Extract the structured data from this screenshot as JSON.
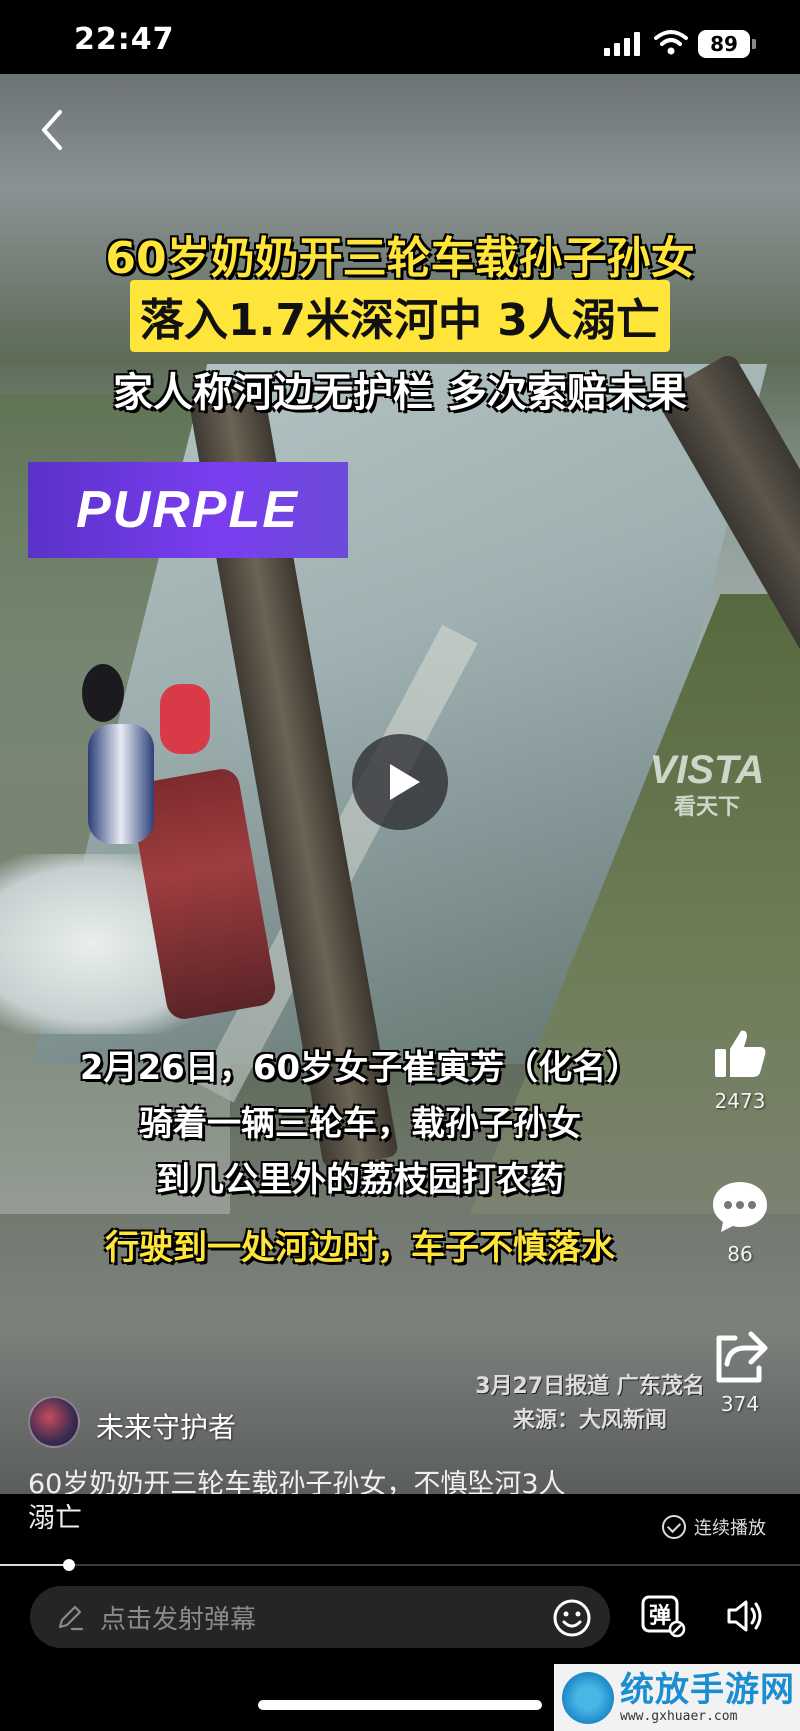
{
  "status_bar": {
    "time": "22:47",
    "battery": "89"
  },
  "video": {
    "title_lines": [
      "60岁奶奶开三轮车载孙子孙女",
      "落入1.7米深河中 3人溺亡",
      "家人称河边无护栏 多次索赔未果"
    ],
    "logo_text": "PURPLE",
    "vista_logo": "VISTA",
    "vista_sub": "看天下",
    "subtitles": [
      "2月26日，60岁女子崔寅芳（化名）",
      "骑着一辆三轮车，载孙子孙女",
      "到几公里外的荔枝园打农药",
      "行驶到一处河边时，车子不慎落水"
    ],
    "report_date": "3月27日报道 广东茂名",
    "report_source": "来源：大风新闻"
  },
  "actions": {
    "likes": "2473",
    "comments": "86",
    "shares": "374"
  },
  "author": {
    "name": "未来守护者"
  },
  "caption": {
    "line1": "60岁奶奶开三轮车载孙子孙女，不慎坠河3人",
    "line2": "溺亡"
  },
  "autoplay_label": "连续播放",
  "playback": {
    "progress_fraction": 0.086
  },
  "danmaku": {
    "placeholder": "点击发射弹幕",
    "toggle_glyph": "弹"
  },
  "watermark": {
    "text": "统放手游网",
    "url": "www.gxhuaer.com"
  },
  "colors": {
    "title_yellow": "#ffe43a",
    "purple_brand": "#6b3de0"
  },
  "icons": [
    "back-icon",
    "signal-icon",
    "wifi-icon",
    "battery-icon",
    "play-icon",
    "thumbs-up-icon",
    "comment-icon",
    "share-icon",
    "check-icon",
    "pen-icon",
    "emoji-icon",
    "danmaku-toggle-icon",
    "volume-icon"
  ]
}
